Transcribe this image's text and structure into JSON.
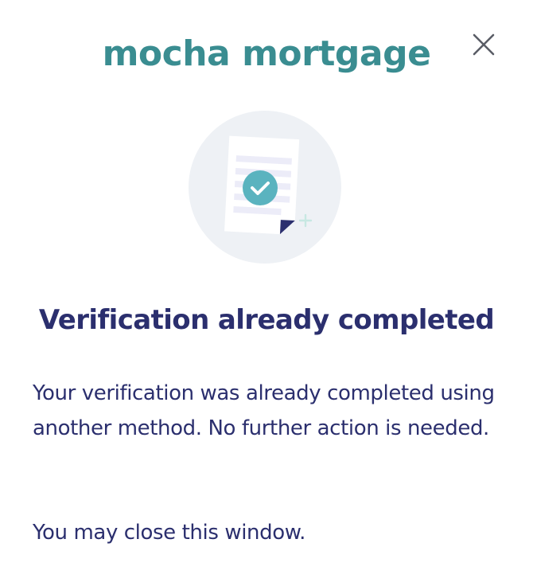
{
  "header": {
    "brand": "mocha mortgage",
    "brand_color": "#3a8d91",
    "close_icon": "close-icon"
  },
  "illustration": {
    "icon": "verified-document-icon",
    "circle_color": "#eef1f5",
    "check_color": "#5ab3bf",
    "accent_color": "#2b2f6e"
  },
  "main": {
    "title": "Verification already completed",
    "message": "Your verification was already completed using another method. No further action is needed.",
    "close_note": "You may close this window."
  },
  "colors": {
    "text": "#2b2f6e"
  }
}
